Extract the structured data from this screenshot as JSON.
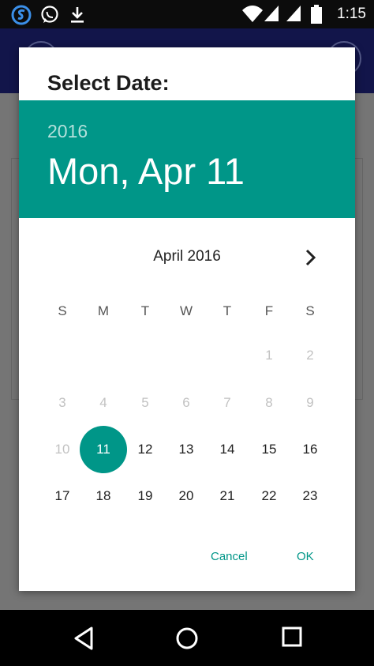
{
  "status_bar": {
    "time": "1:15",
    "icons": [
      "s-app-icon",
      "whatsapp-icon",
      "download-icon",
      "wifi-icon",
      "signal-icon",
      "signal-icon",
      "battery-icon"
    ]
  },
  "dialog": {
    "title": "Select Date:",
    "header": {
      "year": "2016",
      "date": "Mon, Apr 11"
    },
    "month_label": "April 2016",
    "weekdays": [
      "S",
      "M",
      "T",
      "W",
      "T",
      "F",
      "S"
    ],
    "weeks": [
      [
        "",
        "",
        "",
        "",
        "",
        "1",
        "2"
      ],
      [
        "3",
        "4",
        "5",
        "6",
        "7",
        "8",
        "9"
      ],
      [
        "10",
        "11",
        "12",
        "13",
        "14",
        "15",
        "16"
      ],
      [
        "17",
        "18",
        "19",
        "20",
        "21",
        "22",
        "23"
      ]
    ],
    "selected_day": "11",
    "disabled_before": 11,
    "cancel_label": "Cancel",
    "ok_label": "OK"
  },
  "colors": {
    "accent": "#009688",
    "app_bar": "#12154a"
  },
  "nav_bar": {
    "icons": [
      "back-icon",
      "home-icon",
      "recents-icon"
    ]
  }
}
